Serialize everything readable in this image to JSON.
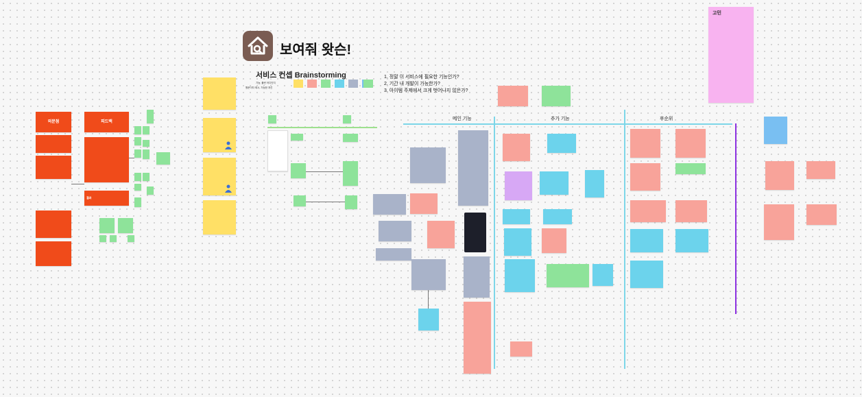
{
  "board": {
    "title": "보여줘 왓슨!",
    "subtitle": "서비스 컨셉 Brainstorming",
    "legend_caption_1": "기능, 폴란 어디인지",
    "legend_caption_2": "원문이자 제시, 가능한 개선",
    "questions": [
      "1. 정말 이 서비스에 필요한 기능인가?",
      "2. 기간 내 개발이 가능한가?",
      "3. 아이템 주제에서 크게 벗어나지 않은가?"
    ]
  },
  "left": {
    "header_1": "의문점",
    "header_2": "피드백",
    "header_3": "결과"
  },
  "columns": {
    "col1": "메인 기능",
    "col2": "추가 기능",
    "col3": "후순위"
  },
  "right_note": {
    "title": "고민"
  },
  "colors": {
    "orange": "#f04b1a",
    "yellow": "#ffe066",
    "pink": "#f8a39a",
    "green": "#8ee39a",
    "blue": "#6cd3ec",
    "slate": "#a9b3c9",
    "lavender": "#d7a8f5",
    "sky": "#79bff2",
    "magenta": "#f8b3f0",
    "divider": "#7dd6e8",
    "purple_line": "#8b2fe0"
  },
  "icons": {
    "logo": "house-search-icon"
  }
}
